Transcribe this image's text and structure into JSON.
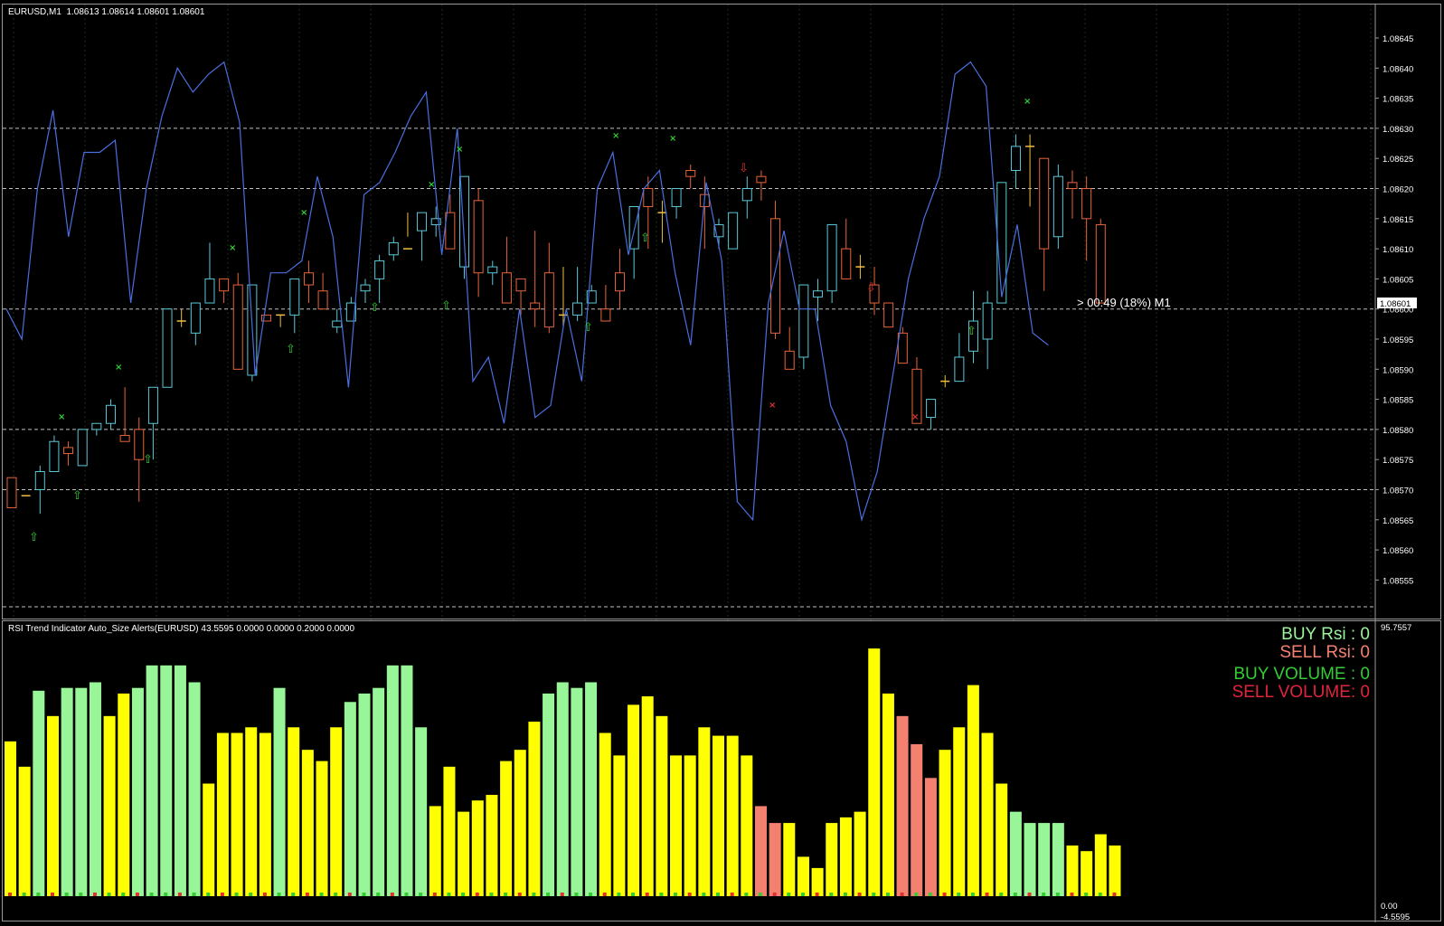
{
  "main_chart": {
    "title": "EURUSD,M1  1.08613 1.08614 1.08601 1.08601",
    "current_price": "1.08601",
    "countdown": "> 00:49 (18%) M1",
    "price_ticks": [
      "1.08645",
      "1.08640",
      "1.08635",
      "1.08630",
      "1.08625",
      "1.08620",
      "1.08615",
      "1.08610",
      "1.08605",
      "1.08600",
      "1.08595",
      "1.08590",
      "1.08585",
      "1.08580",
      "1.08575",
      "1.08570",
      "1.08565",
      "1.08560",
      "1.08555"
    ],
    "colors": {
      "bull": "#5cc8d8",
      "bear": "#e8643a",
      "doji": "#f0c040",
      "line": "#4a6fe0",
      "grid": "#1f3a1f",
      "dash": "#c8c8c8",
      "up_arrow": "#33cc33",
      "down_arrow": "#e03030",
      "x_up": "#33cc33",
      "x_down": "#e03030"
    }
  },
  "indicator": {
    "title": "RSI Trend Indicator Auto_Size Alerts(EURUSD) 43.5595 0.0000 0.0000 0.2000 0.0000",
    "scale_top": "95.7557",
    "scale_bottom_a": "0.00",
    "scale_bottom_b": "-4.5595",
    "buy_rsi": "BUY Rsi : 0",
    "sell_rsi": "SELL Rsi: 0",
    "buy_volume": "BUY VOLUME : 0",
    "sell_volume": "SELL VOLUME: 0",
    "colors": {
      "buy": "#98f598",
      "neutral": "#ffff00",
      "sell": "#f48070",
      "buy_label": "#98f598",
      "sell_label": "#f48070",
      "buy_vol_label": "#33cc33",
      "sell_vol_label": "#e0243c"
    }
  },
  "chart_data": [
    {
      "type": "candlestick",
      "title": "EURUSD,M1",
      "ylim": [
        1.0855,
        1.0865
      ],
      "ohlc": [
        [
          1.08572,
          1.08572,
          1.08567,
          1.08567
        ],
        [
          1.08569,
          1.08569,
          1.08569,
          1.08569
        ],
        [
          1.0857,
          1.08574,
          1.08566,
          1.08573
        ],
        [
          1.08573,
          1.08579,
          1.08573,
          1.08578
        ],
        [
          1.08577,
          1.08578,
          1.08574,
          1.08576
        ],
        [
          1.08574,
          1.0858,
          1.08574,
          1.0858
        ],
        [
          1.0858,
          1.08581,
          1.08579,
          1.08581
        ],
        [
          1.08581,
          1.08585,
          1.0858,
          1.08584
        ],
        [
          1.08579,
          1.08587,
          1.08578,
          1.08578
        ],
        [
          1.0858,
          1.08582,
          1.08568,
          1.08575
        ],
        [
          1.08581,
          1.08587,
          1.08575,
          1.08587
        ],
        [
          1.08587,
          1.086,
          1.08587,
          1.086
        ],
        [
          1.08598,
          1.086,
          1.08597,
          1.08598
        ],
        [
          1.08596,
          1.08601,
          1.08594,
          1.08601
        ],
        [
          1.08601,
          1.08611,
          1.08601,
          1.08605
        ],
        [
          1.08605,
          1.08605,
          1.08601,
          1.08603
        ],
        [
          1.08604,
          1.08606,
          1.0859,
          1.0859
        ],
        [
          1.08589,
          1.08604,
          1.08588,
          1.08604
        ],
        [
          1.08599,
          1.08599,
          1.08598,
          1.08598
        ],
        [
          1.08599,
          1.08599,
          1.08597,
          1.08599
        ],
        [
          1.08599,
          1.08605,
          1.08596,
          1.08605
        ],
        [
          1.08606,
          1.08608,
          1.08601,
          1.08604
        ],
        [
          1.08603,
          1.08606,
          1.086,
          1.086
        ],
        [
          1.08597,
          1.086,
          1.08596,
          1.08598
        ],
        [
          1.08598,
          1.08602,
          1.08598,
          1.08601
        ],
        [
          1.08603,
          1.08605,
          1.08601,
          1.08604
        ],
        [
          1.08605,
          1.08609,
          1.08601,
          1.08608
        ],
        [
          1.08609,
          1.08612,
          1.08608,
          1.08611
        ],
        [
          1.0861,
          1.08616,
          1.08612,
          1.0861
        ],
        [
          1.08613,
          1.08616,
          1.08608,
          1.08616
        ],
        [
          1.08614,
          1.08617,
          1.08612,
          1.08615
        ],
        [
          1.08616,
          1.08619,
          1.0861,
          1.0861
        ],
        [
          1.08607,
          1.08622,
          1.08605,
          1.08622
        ],
        [
          1.08618,
          1.0862,
          1.08602,
          1.08606
        ],
        [
          1.08606,
          1.08608,
          1.08604,
          1.08607
        ],
        [
          1.08606,
          1.08612,
          1.08601,
          1.08601
        ],
        [
          1.08605,
          1.08605,
          1.08599,
          1.08603
        ],
        [
          1.08601,
          1.08613,
          1.08597,
          1.086
        ],
        [
          1.08606,
          1.08611,
          1.08596,
          1.08597
        ],
        [
          1.08599,
          1.08607,
          1.08597,
          1.08599
        ],
        [
          1.08599,
          1.08607,
          1.08598,
          1.08601
        ],
        [
          1.08601,
          1.08604,
          1.08601,
          1.08603
        ],
        [
          1.086,
          1.08604,
          1.08598,
          1.08598
        ],
        [
          1.08606,
          1.0861,
          1.086,
          1.08603
        ],
        [
          1.0861,
          1.08615,
          1.08605,
          1.08617
        ],
        [
          1.0862,
          1.08622,
          1.0861,
          1.08617
        ],
        [
          1.08616,
          1.08618,
          1.08611,
          1.08616
        ],
        [
          1.08617,
          1.0862,
          1.08615,
          1.0862
        ],
        [
          1.08623,
          1.08624,
          1.0862,
          1.08622
        ],
        [
          1.08619,
          1.08622,
          1.0861,
          1.08617
        ],
        [
          1.08612,
          1.08615,
          1.0861,
          1.08614
        ],
        [
          1.0861,
          1.08615,
          1.0861,
          1.08616
        ],
        [
          1.08618,
          1.08622,
          1.08615,
          1.0862
        ],
        [
          1.08622,
          1.08623,
          1.08618,
          1.08621
        ],
        [
          1.08615,
          1.08618,
          1.08595,
          1.08596
        ],
        [
          1.08593,
          1.08597,
          1.0859,
          1.0859
        ],
        [
          1.08592,
          1.08603,
          1.0859,
          1.08604
        ],
        [
          1.08602,
          1.08605,
          1.08598,
          1.08603
        ],
        [
          1.08603,
          1.08614,
          1.08601,
          1.08614
        ],
        [
          1.0861,
          1.08615,
          1.08605,
          1.08605
        ],
        [
          1.08607,
          1.08609,
          1.08605,
          1.08607
        ],
        [
          1.08604,
          1.08607,
          1.08599,
          1.08601
        ],
        [
          1.08601,
          1.08601,
          1.08597,
          1.08597
        ],
        [
          1.08596,
          1.08597,
          1.08591,
          1.08591
        ],
        [
          1.0859,
          1.08592,
          1.08581,
          1.08581
        ],
        [
          1.08582,
          1.08585,
          1.0858,
          1.08585
        ],
        [
          1.08588,
          1.08589,
          1.08587,
          1.08588
        ],
        [
          1.08588,
          1.08596,
          1.08588,
          1.08592
        ],
        [
          1.08593,
          1.08603,
          1.08591,
          1.08598
        ],
        [
          1.08595,
          1.08603,
          1.0859,
          1.08601
        ],
        [
          1.08601,
          1.08617,
          1.08601,
          1.08621
        ],
        [
          1.08623,
          1.08629,
          1.0862,
          1.08627
        ],
        [
          1.08627,
          1.08629,
          1.08617,
          1.08627
        ],
        [
          1.08625,
          1.08625,
          1.08603,
          1.0861
        ],
        [
          1.08612,
          1.08624,
          1.0861,
          1.08622
        ],
        [
          1.08621,
          1.08623,
          1.08615,
          1.0862
        ],
        [
          1.0862,
          1.08622,
          1.08608,
          1.08615
        ],
        [
          1.08614,
          1.08615,
          1.08601,
          1.08601
        ]
      ],
      "overlay_line_description": "blue oscillator line"
    },
    {
      "type": "bar",
      "title": "RSI Trend Indicator Auto_Size Alerts(EURUSD)",
      "ylim": [
        -4.5595,
        95.7557
      ],
      "values": [
        55,
        46,
        73,
        64,
        74,
        74,
        76,
        64,
        72,
        74,
        82,
        82,
        82,
        76,
        40,
        58,
        58,
        60,
        58,
        74,
        60,
        52,
        48,
        60,
        69,
        72,
        74,
        82,
        82,
        60,
        32,
        46,
        30,
        34,
        36,
        48,
        52,
        62,
        72,
        76,
        74,
        76,
        58,
        50,
        68,
        71,
        64,
        50,
        50,
        60,
        57,
        57,
        50,
        32,
        26,
        26,
        14,
        10,
        26,
        28,
        30,
        88,
        72,
        64,
        54,
        42,
        52,
        60,
        75,
        58,
        40,
        30,
        26,
        26,
        26,
        18,
        16,
        22,
        18
      ],
      "categories_colors": "buy/neutral/sell"
    }
  ]
}
